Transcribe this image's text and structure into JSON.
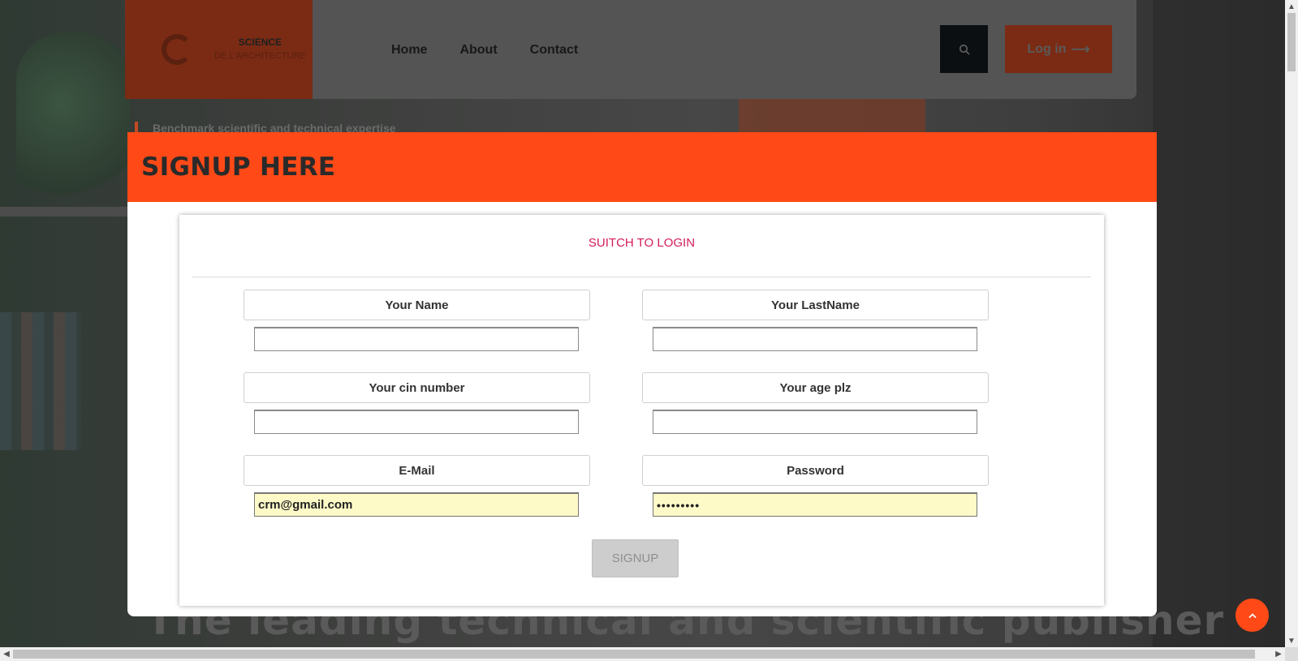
{
  "background": {
    "tagline": "Benchmark scientific and technical expertise",
    "headline": "The leading technical and scientific publisher"
  },
  "navbar": {
    "brand_line1": "SCIENCE",
    "brand_line2": "DE L'ARCHITECTURE",
    "links": [
      "Home",
      "About",
      "Contact"
    ],
    "login_label": "Log in",
    "login_arrow": "⟶"
  },
  "modal": {
    "title": "SIGNUP HERE",
    "switch_label": "SUITCH TO LOGIN",
    "fields": {
      "name": {
        "label": "Your Name",
        "value": ""
      },
      "lastname": {
        "label": "Your LastName",
        "value": ""
      },
      "cin": {
        "label": "Your cin number",
        "value": ""
      },
      "age": {
        "label": "Your age plz",
        "value": ""
      },
      "email": {
        "label": "E-Mail",
        "value": "crm@gmail.com"
      },
      "password": {
        "label": "Password",
        "value": "•••••••••"
      }
    },
    "signup_label": "SIGNUP"
  },
  "colors": {
    "accent": "#ff4a17",
    "switch_link": "#d41b5a",
    "autofill_bg": "#fefac8"
  },
  "icons": {
    "search": "search-icon",
    "back_to_top": "chevron-up-icon"
  }
}
